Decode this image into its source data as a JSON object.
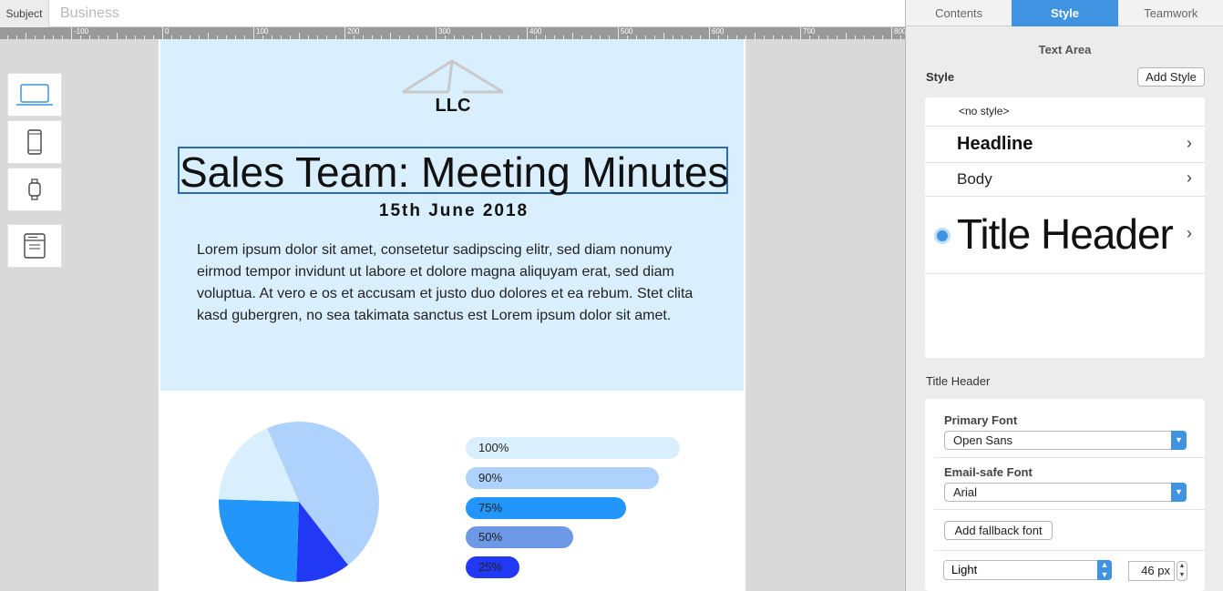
{
  "subject": {
    "label": "Subject",
    "value": "Business"
  },
  "ruler": {
    "labels": [
      "-100",
      "0",
      "100",
      "200",
      "300",
      "400",
      "500",
      "600",
      "700",
      "800"
    ]
  },
  "devices": [
    "laptop-icon",
    "phone-icon",
    "watch-icon",
    "email-client-icon"
  ],
  "email": {
    "logo_text": "LLC",
    "title": "Sales Team: Meeting Minutes",
    "date": "15th June 2018",
    "body": "Lorem ipsum dolor sit amet, consetetur sadipscing elitr, sed diam nonumy eirmod tempor invidunt ut labore et dolore magna aliquyam erat, sed diam voluptua. At vero e os et accusam et justo duo dolores et ea rebum. Stet clita kasd gubergren, no sea takimata sanctus est Lorem ipsum dolor sit amet."
  },
  "chart_data": [
    {
      "type": "pie",
      "title": "",
      "slices": [
        {
          "value": 46,
          "color": "#aed2fb"
        },
        {
          "value": 11,
          "color": "#2139f5"
        },
        {
          "value": 25,
          "color": "#2396fc"
        },
        {
          "value": 18,
          "color": "#d9effd"
        }
      ]
    },
    {
      "type": "bar",
      "orientation": "horizontal",
      "categories": [
        "100%",
        "90%",
        "75%",
        "50%",
        "25%"
      ],
      "values": [
        100,
        90,
        75,
        50,
        25
      ],
      "colors": [
        "#d9effd",
        "#aed2fb",
        "#2396fc",
        "#6d98e5",
        "#2139f5"
      ]
    }
  ],
  "inspector": {
    "tabs": [
      "Contents",
      "Style",
      "Teamwork"
    ],
    "active_tab": "Style",
    "section_title": "Text Area",
    "style_label": "Style",
    "add_style_label": "Add Style",
    "styles": [
      "<no style>",
      "Headline",
      "Body",
      "Title Header"
    ],
    "selected_style": "Title Header",
    "current_style_heading": "Title Header",
    "primary_font_label": "Primary Font",
    "primary_font": "Open Sans",
    "email_safe_font_label": "Email-safe Font",
    "email_safe_font": "Arial",
    "fallback_label": "Add fallback font",
    "weight": "Light",
    "size": "46 px"
  },
  "colors": {
    "accent": "#3f93e0",
    "hero_bg": "#d9effd",
    "title_border": "#2a6bb0"
  }
}
